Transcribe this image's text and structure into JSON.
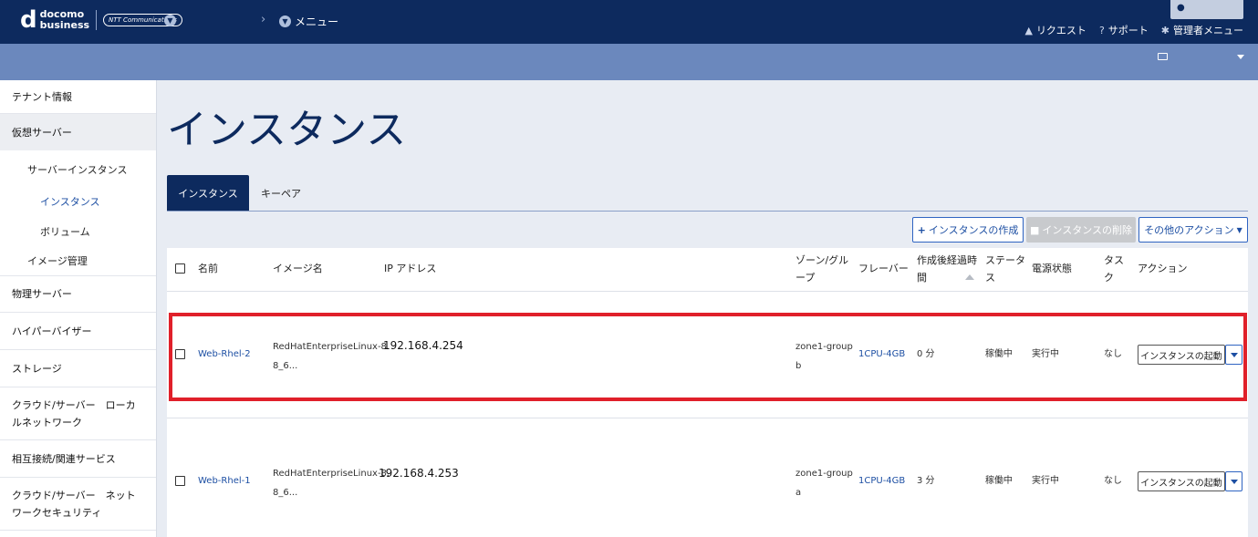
{
  "header": {
    "logo_top": "docomo",
    "logo_bottom": "business",
    "logo_ntt": "NTT Communications",
    "menu_label": "メニュー",
    "links": [
      {
        "icon": "bell-icon",
        "label": "リクエスト"
      },
      {
        "icon": "help-icon",
        "label": "サポート"
      },
      {
        "icon": "gear-icon",
        "label": "管理者メニュー"
      }
    ]
  },
  "sidebar": {
    "items": [
      {
        "label": "テナント情報"
      },
      {
        "label": "仮想サーバー"
      },
      {
        "label": "物理サーバー"
      },
      {
        "label": "ハイパーバイザー"
      },
      {
        "label": "ストレージ"
      },
      {
        "label": "クラウド/サーバー　ローカルネットワーク"
      },
      {
        "label": "相互接続/関連サービス"
      },
      {
        "label": "クラウド/サーバー　ネットワークセキュリティ"
      }
    ],
    "sub_items": [
      {
        "label": "サーバーインスタンス"
      },
      {
        "label": "インスタンス"
      },
      {
        "label": "ボリューム"
      },
      {
        "label": "イメージ管理"
      }
    ]
  },
  "main": {
    "title": "インスタンス",
    "tabs": [
      {
        "label": "インスタンス"
      },
      {
        "label": "キーペア"
      }
    ],
    "buttons": {
      "create": "インスタンスの作成",
      "delete": "インスタンスの削除",
      "other": "その他のアクション"
    }
  },
  "table": {
    "columns": {
      "name": "名前",
      "image": "イメージ名",
      "ip": "IP アドレス",
      "zone_l1": "ゾーン/グル",
      "zone_l2": "ープ",
      "flavor": "フレーバー",
      "elapsed_l1": "作成後経過時",
      "elapsed_l2": "間",
      "status_l1": "ステータ",
      "status_l2": "ス",
      "power": "電源状態",
      "task_l1": "タス",
      "task_l2": "ク",
      "action": "アクション"
    },
    "rows": [
      {
        "name": "Web-Rhel-2",
        "image_l1": "RedHatEnterpriseLinux-8.",
        "image_l2": "8_6...",
        "ip": "192.168.4.254",
        "zone_l1": "zone1-group",
        "zone_l2": "b",
        "flavor": "1CPU-4GB",
        "elapsed": "0 分",
        "status": "稼働中",
        "power": "実行中",
        "task": "なし",
        "action": "インスタンスの起動"
      },
      {
        "name": "Web-Rhel-1",
        "image_l1": "RedHatEnterpriseLinux-8.",
        "image_l2": "8_6...",
        "ip": "192.168.4.253",
        "zone_l1": "zone1-group",
        "zone_l2": "a",
        "flavor": "1CPU-4GB",
        "elapsed": "3 分",
        "status": "稼働中",
        "power": "実行中",
        "task": "なし",
        "action": "インスタンスの起動"
      }
    ]
  },
  "colors": {
    "header_bg": "#0d2a5e",
    "subbar_bg": "#6b88bd",
    "accent": "#1d4fa3",
    "highlight": "#e0202a"
  }
}
